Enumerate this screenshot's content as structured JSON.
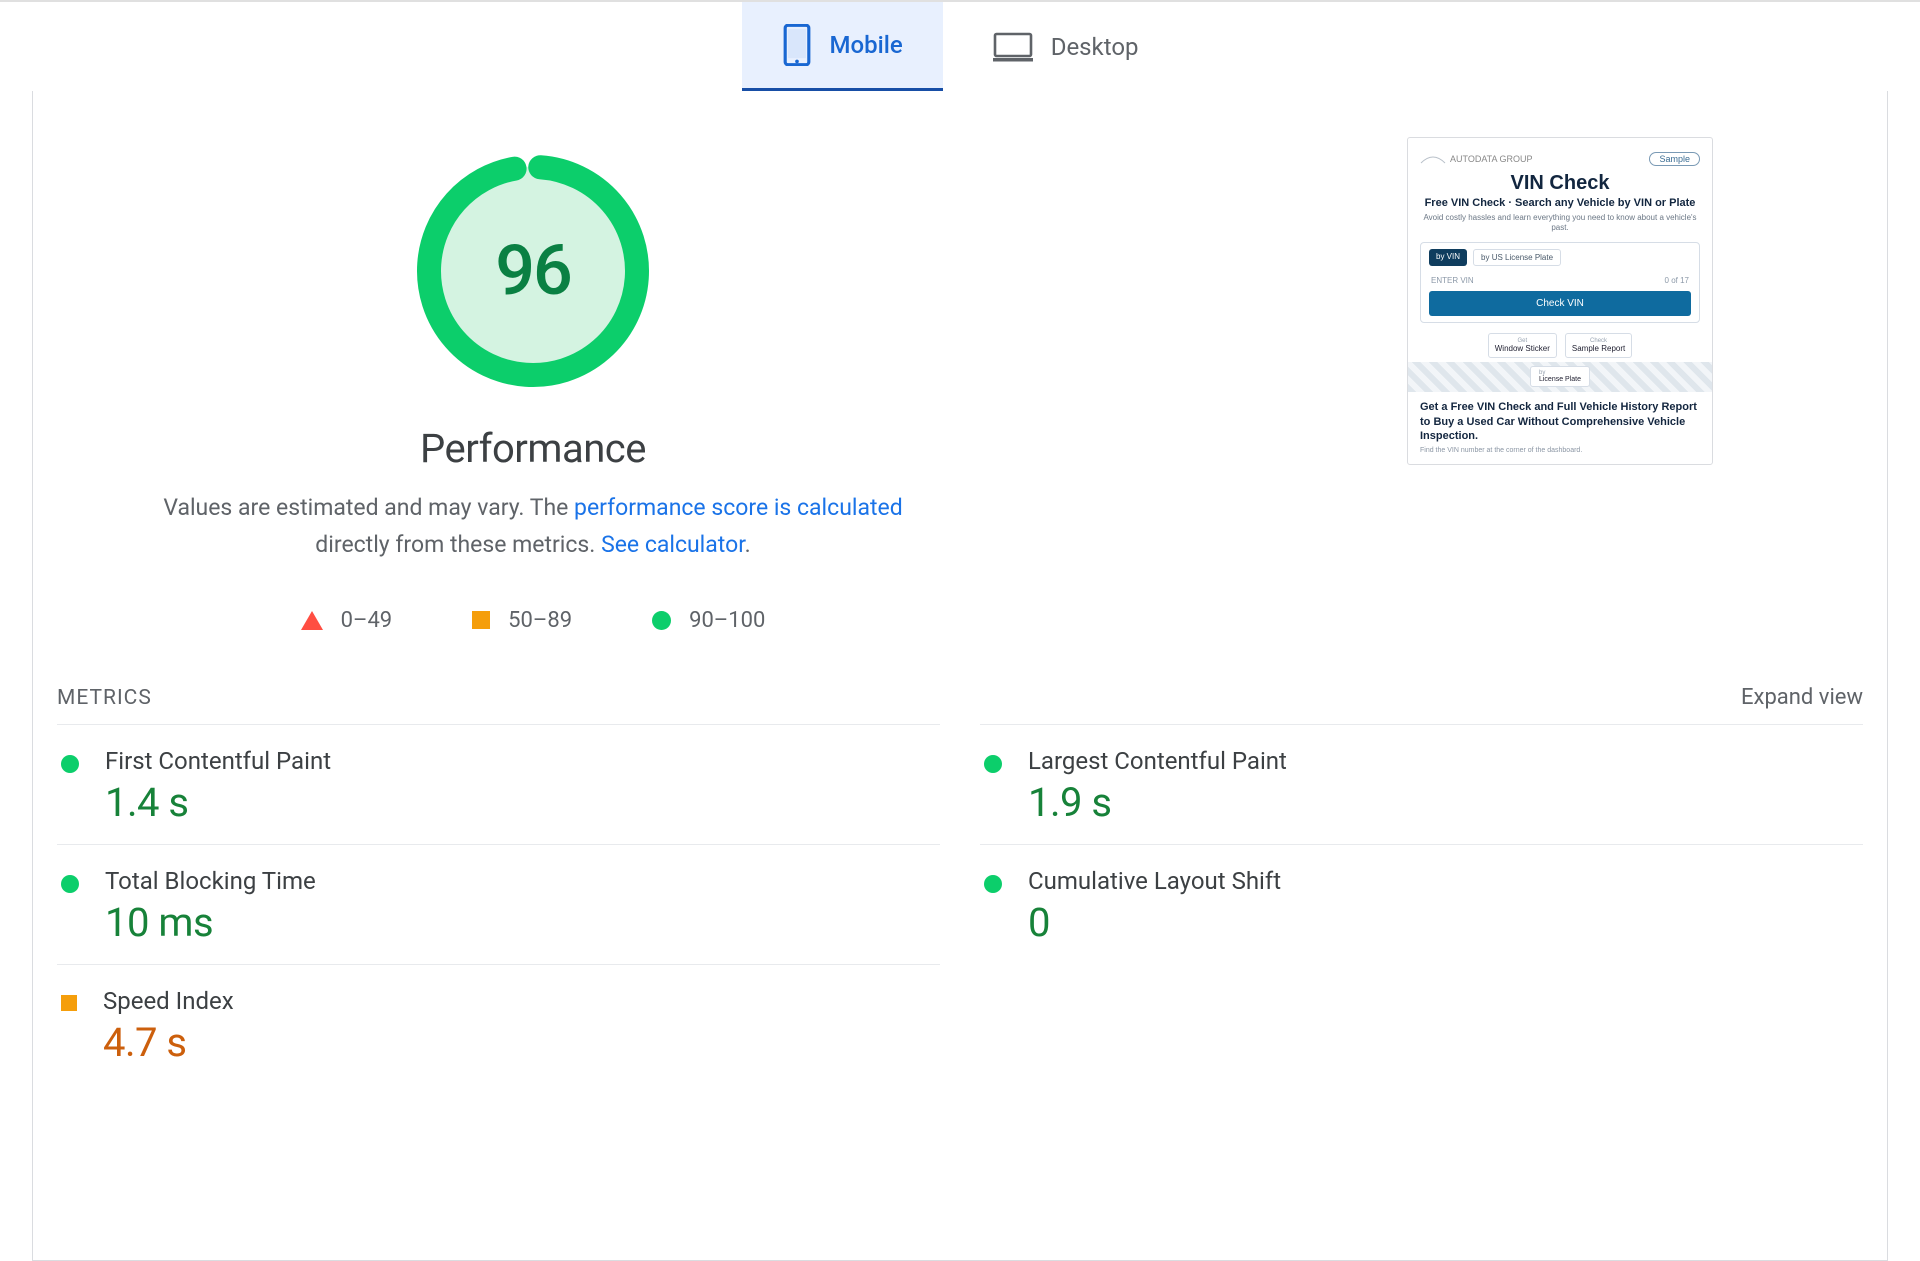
{
  "tabs": {
    "mobile": "Mobile",
    "desktop": "Desktop"
  },
  "gauge": {
    "score": "96",
    "title": "Performance",
    "desc_prefix": "Values are estimated and may vary. The ",
    "link1": "performance score is calculated",
    "desc_mid": " directly from these metrics. ",
    "link2": "See calculator",
    "desc_suffix": "."
  },
  "legend": {
    "poor": "0–49",
    "avg": "50–89",
    "good": "90–100"
  },
  "preview": {
    "logo": "AUTODATA GROUP",
    "badge": "Sample",
    "h": "VIN Check",
    "sub": "Free VIN Check · Search any Vehicle by VIN or Plate",
    "tiny": "Avoid costly hassles and learn everything you need to know about a vehicle's past.",
    "tab_a": "by VIN",
    "tab_b": "by US License Plate",
    "ph": "ENTER VIN",
    "counter": "0 of 17",
    "cta": "Check VIN",
    "mini1_top": "Get",
    "mini1": "Window Sticker",
    "mini2_top": "Check",
    "mini2": "Sample Report",
    "lic_top": "by",
    "lic": "License Plate",
    "para": "Get a Free VIN Check and Full Vehicle History Report to Buy a Used Car Without Comprehensive Vehicle Inspection.",
    "fine": "Find the VIN number at the corner of the dashboard."
  },
  "metrics": {
    "heading": "METRICS",
    "expand": "Expand view",
    "items": [
      {
        "name": "First Contentful Paint",
        "value": "1.4 s",
        "status": "green"
      },
      {
        "name": "Largest Contentful Paint",
        "value": "1.9 s",
        "status": "green"
      },
      {
        "name": "Total Blocking Time",
        "value": "10 ms",
        "status": "green"
      },
      {
        "name": "Cumulative Layout Shift",
        "value": "0",
        "status": "green"
      },
      {
        "name": "Speed Index",
        "value": "4.7 s",
        "status": "orange"
      }
    ]
  }
}
